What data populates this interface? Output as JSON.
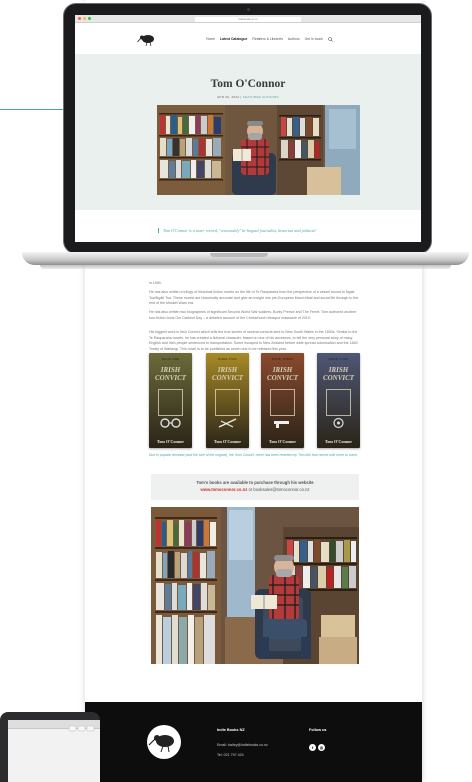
{
  "site": {
    "nav": [
      "Home",
      "Latest Catalogue",
      "Retailers & Libraries",
      "Authors",
      "Get In touch"
    ],
    "active_index": 1,
    "url": "indiebooks.co.nz"
  },
  "article": {
    "title": "Tom O'Connor",
    "date": "APR 20, 2022",
    "separator": " | ",
    "category": "FEATURED AUTHORS",
    "quote": "Tom O'Connor is a semi- retired, \"reasonably\" bi-lingual journalist, historian and political",
    "para_1_tail": "in 1980.",
    "para_2": "He has also written a trilogy of historical fiction novels on the life of Te Rauparaha from the perspective of a vessel bound to Ngati Toa/Ngāti Toa. These novels are historically accurate and give an insight into pre-European Maori tribal and social life through to the end of the Musket Wars era.",
    "para_3": "He has also written two biographies of significant Second World War soldiers, Bunty Preece and The Ferret. Tom authored another non-fiction book Our Darkest Day – a detailed account of the Christchurch Mosque massacre of 2019.",
    "para_4": "His biggest work is Irish Convict which tells the true stories of several convicts sent to New South Wales in the 1830s. Similar to the Te Rauparaha novels, he has created a fictional character, based on one of his ancestors, to tell the very personal story of many English and Irish people sentenced to transportation. Some escaped to New Zealand before wide spread colonisation and the 1840 Treaty of Waitangi. This novel is to be published as seven due to be released this year.",
    "caption": "Due to popular demand (and the size of the original), the 'Irish Convict' novel has been rewritten by Tom into four novels with more to come."
  },
  "books": [
    {
      "top": "BOOK ONE",
      "title_1": "IRISH",
      "title_2": "CONVICT",
      "author": "Tom O'Connor",
      "color": "#6b6b3a"
    },
    {
      "top": "BOOK TWO",
      "title_1": "IRISH",
      "title_2": "CONVICT",
      "author": "Tom O'Connor",
      "color": "#a88a26"
    },
    {
      "top": "BOOK THREE",
      "title_1": "IRISH",
      "title_2": "CONVICT",
      "author": "Tom O'Connor",
      "color": "#8b4a2e"
    },
    {
      "top": "BOOK FOUR",
      "title_1": "IRISH",
      "title_2": "CONVICT",
      "author": "Tom O'Connor",
      "color": "#4f5775"
    }
  ],
  "buy": {
    "line_1": "Tom's books are available to purchase through his website",
    "link": "www.tomoconnor.co.nz",
    "mid": " or ",
    "email": "booksales@tomoconnor.co.nz"
  },
  "footer": {
    "company": "Indie Books NZ",
    "email": "Email: bailey@indiebooks.co.nz",
    "tel": "Tel: 021 797 424",
    "follow": "Follow us",
    "fb": "f",
    "ig": "◎"
  },
  "colors": {
    "teal": "#4aa7a2",
    "hero_bg": "#e9f0ee",
    "footer_bg": "#0d0d0d",
    "link_red": "#c0392b"
  },
  "icons": [
    "kiwi-logo-icon",
    "search-icon",
    "facebook-icon",
    "instagram-icon"
  ]
}
